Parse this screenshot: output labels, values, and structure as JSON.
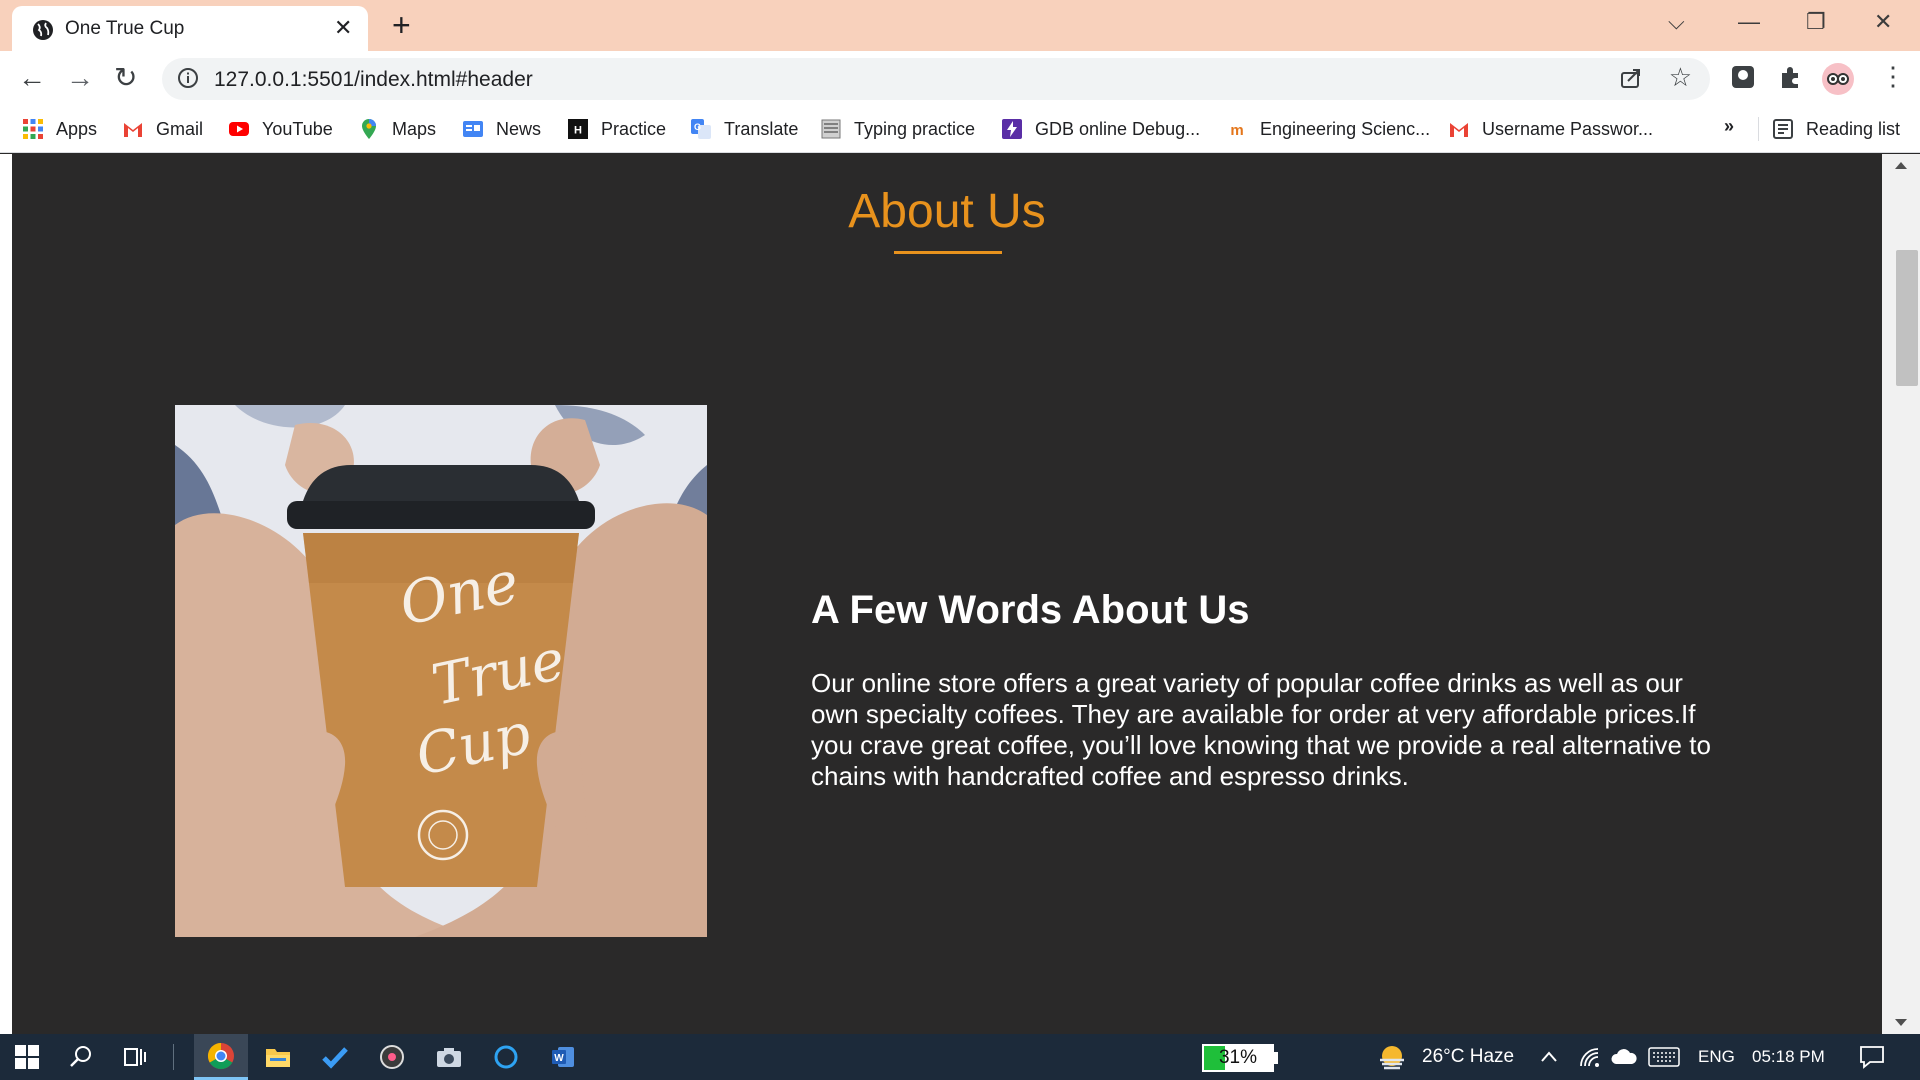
{
  "browser": {
    "tab_title": "One True Cup",
    "tab_close": "✕",
    "new_tab": "+",
    "url": "127.0.0.1:5501/index.html#header",
    "window_controls": {
      "tab_search": "⌵",
      "minimize": "—",
      "restore": "❐",
      "close": "✕"
    },
    "nav": {
      "back": "←",
      "forward": "→",
      "reload": "↻"
    },
    "star": "☆",
    "menu": "⋮"
  },
  "bookmarks": {
    "items": [
      {
        "label": "Apps",
        "icon": "apps-grid-icon"
      },
      {
        "label": "Gmail",
        "icon": "gmail-icon"
      },
      {
        "label": "YouTube",
        "icon": "youtube-icon"
      },
      {
        "label": "Maps",
        "icon": "maps-pin-icon"
      },
      {
        "label": "News",
        "icon": "google-news-icon"
      },
      {
        "label": "Practice",
        "icon": "hackerrank-icon"
      },
      {
        "label": "Translate",
        "icon": "google-translate-icon"
      },
      {
        "label": "Typing practice",
        "icon": "typing-icon"
      },
      {
        "label": "GDB online Debug...",
        "icon": "gdb-icon"
      },
      {
        "label": "Engineering Scienc...",
        "icon": "engineering-icon"
      },
      {
        "label": "Username Passwor...",
        "icon": "gmail-icon"
      }
    ],
    "more": "»",
    "reading_list": "Reading list"
  },
  "page": {
    "section_title": "About Us",
    "heading": "A Few Words About Us",
    "body": "Our online store offers a great variety of popular coffee drinks as well as our own specialty coffees. They are available for order at very affordable prices.If you crave great coffee, you’ll love knowing that we provide a real alternative to chains with handcrafted coffee and espresso drinks.",
    "cup_script": {
      "line1": "One",
      "line2": "True",
      "line3": "Cup"
    }
  },
  "taskbar": {
    "battery_percent": "31%",
    "battery_level": 0.31,
    "weather": "26°C  Haze",
    "language": "ENG",
    "time": "05:18 PM"
  },
  "colors": {
    "accent": "#e8921d",
    "page_bg": "#2a2929",
    "titlebar_bg": "#f8d1bc",
    "taskbar_bg": "#1c2a3a"
  }
}
